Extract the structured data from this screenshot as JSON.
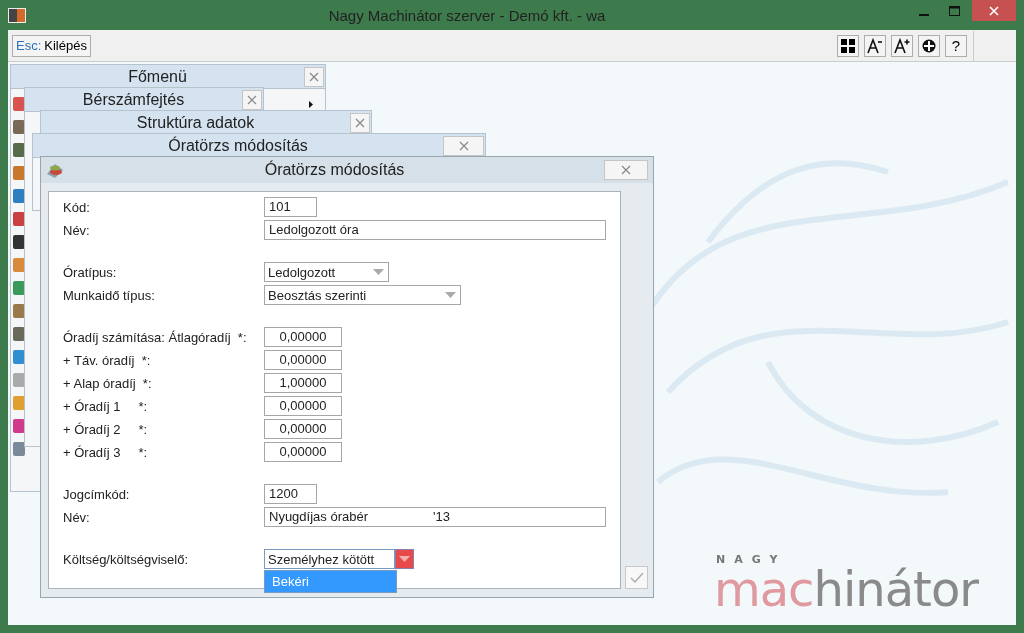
{
  "window": {
    "title": "Nagy Machinátor szerver - Demó kft. - wa"
  },
  "toolbar": {
    "exit_button": {
      "key": "Esc:",
      "label": "Kilépés"
    },
    "tools": [
      {
        "kind": "tiles"
      },
      {
        "kind": "font_smaller"
      },
      {
        "kind": "font_larger"
      },
      {
        "kind": "circle"
      },
      {
        "kind": "help",
        "label": "?"
      }
    ]
  },
  "windows": [
    {
      "title": "Főmenü"
    },
    {
      "title": "Bérszámfejtés"
    },
    {
      "title": "Struktúra adatok"
    },
    {
      "title": "Óratörzs módosítás"
    }
  ],
  "dialog": {
    "title": "Óratörzs módosítás",
    "sections": [
      [
        {
          "kind": "code",
          "label": "Kód:",
          "value": "101"
        },
        {
          "kind": "text",
          "label": "Név:",
          "value": "Ledolgozott óra"
        }
      ],
      [
        {
          "kind": "combo",
          "label": "Óratípus:",
          "value": "Ledolgozott"
        },
        {
          "kind": "combo_wide",
          "label": "Munkaidő típus:",
          "value": "Beosztás szerinti"
        }
      ],
      [
        {
          "kind": "number",
          "label": "Óradíj számítása: Átlagóradíj  *:",
          "value": "0,00000"
        },
        {
          "kind": "number",
          "label": "+ Táv. óradíj  *:",
          "value": "0,00000"
        },
        {
          "kind": "number",
          "label": "+ Alap óradíj  *:",
          "value": "1,00000"
        },
        {
          "kind": "number",
          "label": "+ Óradíj 1     *:",
          "value": "0,00000"
        },
        {
          "kind": "number",
          "label": "+ Óradíj 2     *:",
          "value": "0,00000"
        },
        {
          "kind": "number",
          "label": "+ Óradíj 3     *:",
          "value": "0,00000"
        }
      ],
      [
        {
          "kind": "code",
          "label": "Jogcímkód:",
          "value": "1200"
        },
        {
          "kind": "text",
          "label": "Név:",
          "value": "Nyugdíjas órabér                  '13"
        }
      ],
      [
        {
          "kind": "select",
          "label": "Költség/költségviselő:",
          "value": "Személyhez kötött",
          "open": true,
          "options": [
            {
              "label": "Bekéri",
              "selected": true
            }
          ]
        }
      ]
    ]
  },
  "logo": {
    "tagline": "NAGY",
    "word_parts": [
      "mac",
      "hinátor"
    ]
  }
}
